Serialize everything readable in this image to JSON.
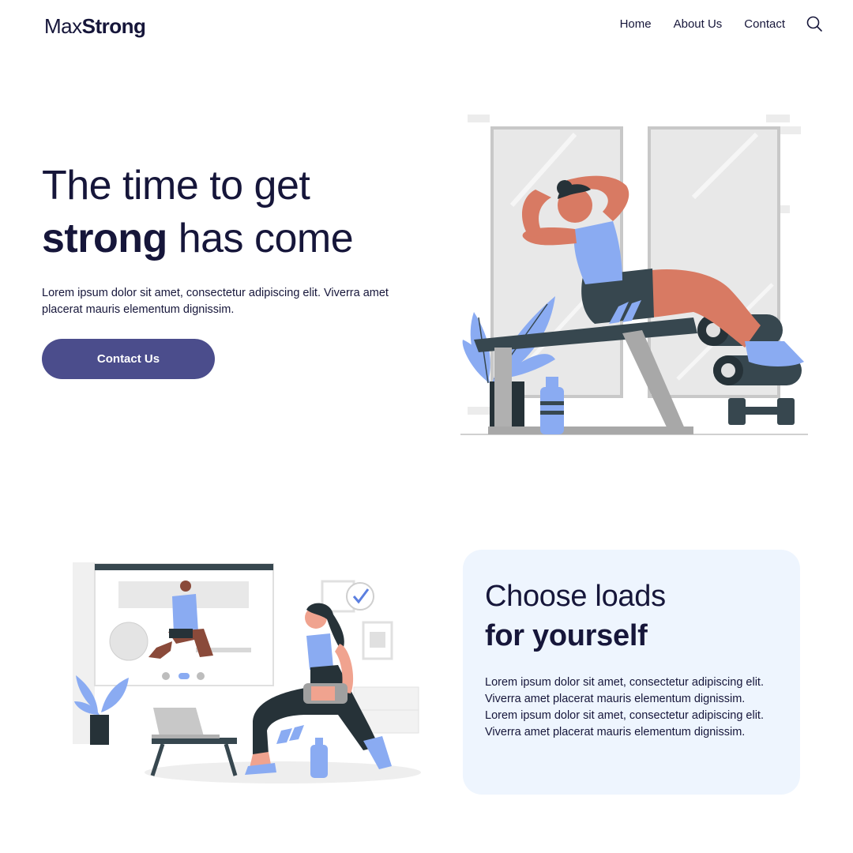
{
  "brand": {
    "name_light": "Max",
    "name_bold": "Strong"
  },
  "nav": {
    "items": [
      "Home",
      "About Us",
      "Contact"
    ]
  },
  "hero": {
    "title_line1": "The time to get",
    "title_bold": "strong",
    "title_rest": " has come",
    "description": "Lorem ipsum dolor sit amet, consectetur adipiscing elit. Viverra amet placerat mauris elementum dignissim.",
    "cta_label": "Contact Us"
  },
  "feature": {
    "title_line1": "Choose loads",
    "title_line2": "for yourself",
    "paragraph1": "Lorem ipsum dolor sit amet, consectetur adipiscing elit. Viverra amet placerat mauris elementum dignissim.",
    "paragraph2": "Lorem ipsum dolor sit amet, consectetur adipiscing elit. Viverra amet placerat mauris elementum dignissim."
  },
  "icons": {
    "search": "search-icon"
  },
  "colors": {
    "primary": "#4b4d8c",
    "text": "#16163a",
    "card_bg": "#eef5fe",
    "accent_blue": "#8aabf2",
    "skin": "#d87a63",
    "dark": "#37474f"
  }
}
